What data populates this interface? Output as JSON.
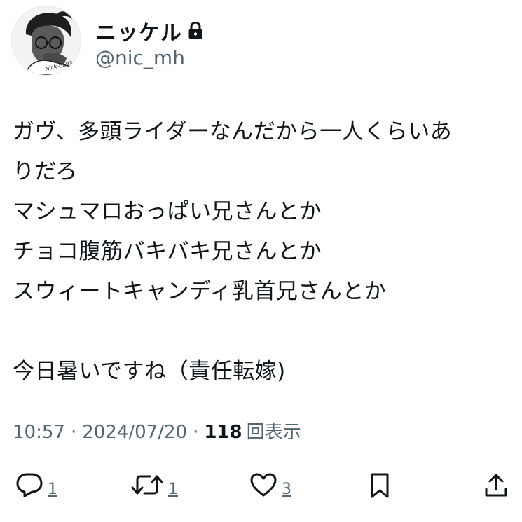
{
  "author": {
    "display_name": "ニッケル",
    "handle": "@nic_mh",
    "avatar_label": "Nick-ba93",
    "protected_icon": "lock-icon"
  },
  "tweet": {
    "lines": [
      "ガヴ、多頭ライダーなんだから一人くらいあ",
      "りだろ",
      "マシュマロおっぱい兄さんとか",
      "チョコ腹筋バキバキ兄さんとか",
      "スウィートキャンディ乳首兄さんとか",
      "",
      "今日暑いですね（責任転嫁)"
    ]
  },
  "meta": {
    "time": "10:57",
    "separator": "·",
    "date": "2024/07/20",
    "views_count": "118",
    "views_label": "回表示"
  },
  "actions": {
    "reply_count": "1",
    "retweet_count": "1",
    "like_count": "3"
  },
  "colors": {
    "text": "#0f1419",
    "secondary": "#536471"
  }
}
